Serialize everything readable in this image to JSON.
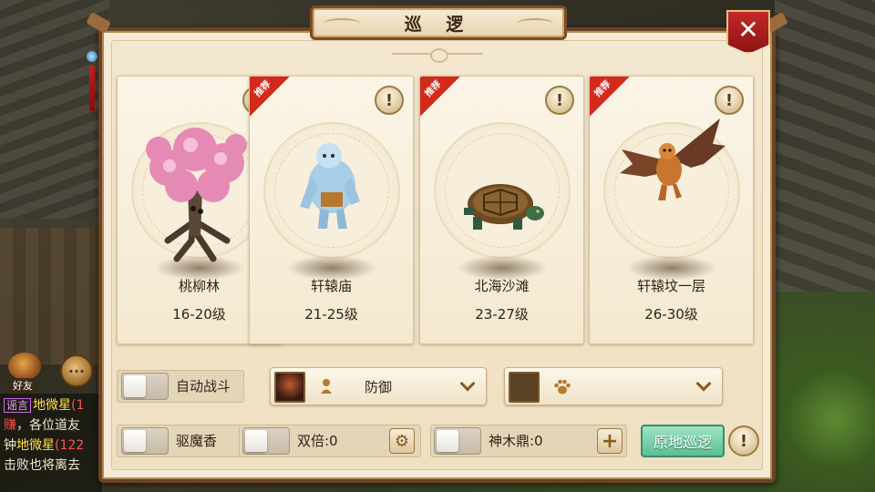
{
  "window": {
    "title": "巡 逻",
    "close_symbol": "✕"
  },
  "cards": [
    {
      "name": "桃柳林",
      "level": "16-20级",
      "recommended": false,
      "info_symbol": "!",
      "monster_icon": "blossom-tree-monster"
    },
    {
      "name": "轩辕庙",
      "level": "21-25级",
      "recommended": true,
      "ribbon_label": "推荐",
      "info_symbol": "!",
      "monster_icon": "yeti-monster"
    },
    {
      "name": "北海沙滩",
      "level": "23-27级",
      "recommended": true,
      "ribbon_label": "推荐",
      "info_symbol": "!",
      "monster_icon": "turtle-monster"
    },
    {
      "name": "轩辕坟一层",
      "level": "26-30级",
      "recommended": true,
      "ribbon_label": "推荐",
      "info_symbol": "!",
      "monster_icon": "bat-demon-monster"
    }
  ],
  "controls": {
    "auto_battle_label": "自动战斗",
    "exorcism_incense_label": "驱魔香",
    "double_label": "双倍:0",
    "shenmuding_label": "神木鼎:0",
    "stance_dropdown": {
      "value": "防御",
      "icon": "person-icon"
    },
    "pet_dropdown": {
      "value": "",
      "icon": "paw-icon"
    },
    "patrol_button": "原地巡逻",
    "info_symbol": "!",
    "gear_symbol": "⚙",
    "plus_symbol": "+"
  },
  "hud": {
    "friend_label": "好友",
    "chat_lines": [
      {
        "tag": "谣言",
        "name": "地微星",
        "level": "(1"
      },
      {
        "text_red": "赚",
        "text": "，各位道友"
      },
      {
        "prefix": "钟",
        "name": "地微星",
        "level": "(122"
      },
      {
        "text": "击败也将离去"
      }
    ]
  }
}
